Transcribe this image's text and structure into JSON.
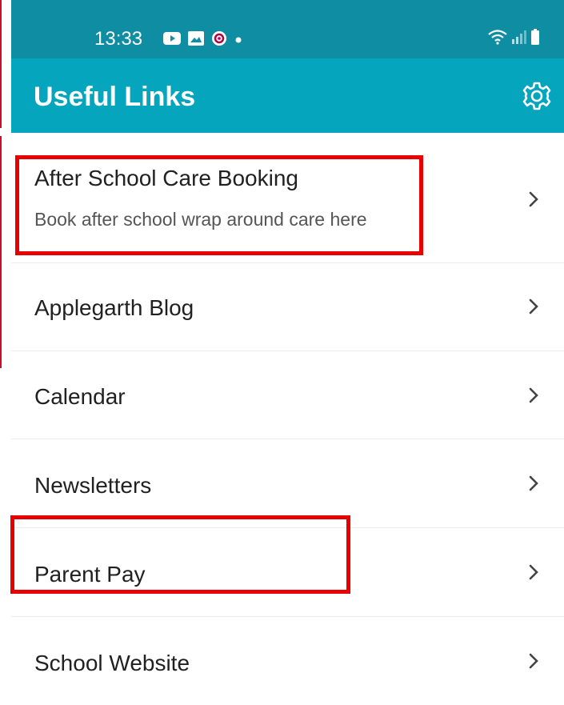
{
  "status_bar": {
    "time": "13:33",
    "icons": [
      "youtube-icon",
      "image-icon",
      "record-icon",
      "dot-icon",
      "wifi-icon",
      "signal-icon",
      "battery-icon"
    ]
  },
  "app_bar": {
    "title": "Useful Links",
    "settings_icon": "gear-icon"
  },
  "links": [
    {
      "title": "After School Care Booking",
      "subtitle": "Book after school wrap around care here"
    },
    {
      "title": "Applegarth Blog"
    },
    {
      "title": "Calendar"
    },
    {
      "title": "Newsletters"
    },
    {
      "title": "Parent Pay"
    },
    {
      "title": "School Website"
    }
  ],
  "colors": {
    "status_bar": "#0e8da3",
    "app_bar": "#05a5bd",
    "highlight": "#e60000",
    "text": "#212121"
  }
}
